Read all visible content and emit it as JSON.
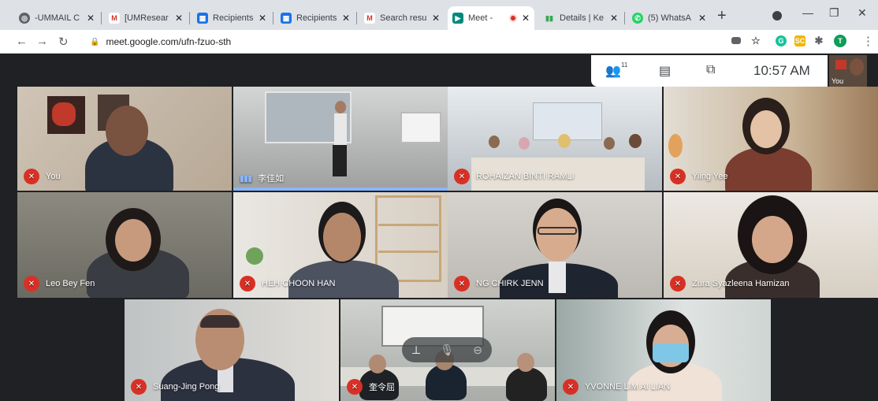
{
  "tabs": [
    {
      "title": "-UMMAIL C",
      "icon": "ummail-icon",
      "color": "#5f6368"
    },
    {
      "title": "[UMResear",
      "icon": "gmail-icon",
      "color": "#d93025"
    },
    {
      "title": "Recipients |",
      "icon": "recipients-icon",
      "color": "#1a73e8"
    },
    {
      "title": "Recipients |",
      "icon": "recipients-icon",
      "color": "#1a73e8"
    },
    {
      "title": "Search resu",
      "icon": "gmail-icon",
      "color": "#d93025"
    },
    {
      "title": "Meet -",
      "icon": "meet-icon",
      "color": "#00897b"
    },
    {
      "title": "Details | Ke",
      "icon": "details-icon",
      "color": "#34a853"
    },
    {
      "title": "(5) WhatsA",
      "icon": "whatsapp-icon",
      "color": "#25d366"
    }
  ],
  "address": {
    "url": "meet.google.com/ufn-fzuo-sth"
  },
  "meeting": {
    "people_count": "11",
    "clock": "10:57 AM",
    "self_label": "You"
  },
  "participants": [
    {
      "name": "You",
      "muted": true
    },
    {
      "name": "李佳如",
      "muted": false,
      "speaking": true
    },
    {
      "name": "ROHAIZAN BINTI RAMLI",
      "muted": true
    },
    {
      "name": "Yiing Yee",
      "muted": true
    },
    {
      "name": "Leo Bey Fen",
      "muted": true
    },
    {
      "name": "HEH CHOON HAN",
      "muted": true
    },
    {
      "name": "NG CHIRK JENN",
      "muted": true
    },
    {
      "name": "Zura Syazleena Hamizan",
      "muted": true
    },
    {
      "name": "Suang-Jing Pong",
      "muted": true
    },
    {
      "name": "奎令屈",
      "muted": true
    },
    {
      "name": "YVONNE LIM AI LIAN",
      "muted": true
    }
  ],
  "colors": {
    "accent": "#8ab4f8",
    "muted_red": "#d93025",
    "meet_bg": "#202124"
  }
}
